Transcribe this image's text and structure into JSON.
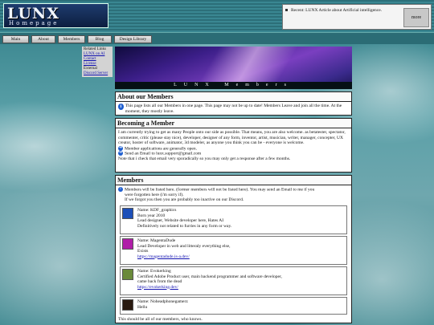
{
  "header": {
    "logo_big": "LUNX",
    "logo_small": "Homepage",
    "notice_text": "Recent: LUNX Article about Artificial intelligence.",
    "notice_more": "more"
  },
  "nav": {
    "items": [
      "Main",
      "About",
      "Members",
      "Blog",
      "Design Library"
    ]
  },
  "sidebar": {
    "heading": "Related Links",
    "links": [
      "LUNX on AI",
      "Contact",
      "License"
    ],
    "external_heading": "External",
    "external_links": [
      "Discord Server"
    ]
  },
  "banner": {
    "caption": "LUNX Members"
  },
  "about": {
    "title": "About our Members",
    "text": "This page lists all our Members in one page. This page may not be up to date! Members Leave and join all the time. At the moment, they mostly leave."
  },
  "becoming": {
    "title": "Becoming a Member",
    "text": "I am currently trying to get as many People onto our side as possible. That means, you are also welcome. as betatester, spectator, commenter, critic (please stay nice), developer, designer of any form, inventor, artist, musician, writer, manager, concepter, UX creator, hoster of software, animator, 3d modeler, as anyone you think you can be - everyone is welcome.",
    "line1": "Member applications are generally open.",
    "line2": "Send an Email to lunx.support@gmail.com",
    "note": "Note that i check that email very sporadically so you may only get a response after a few months."
  },
  "members": {
    "title": "Members",
    "intro1": "Members will be listed here. (former members will not be listed here). You may send an Email to me if you",
    "intro2": "were forgotten here (i'm sorry if).",
    "intro3": "If we forgot you then you are probably too inactive on our Discord.",
    "list": [
      {
        "name": "Name: KDF_graphics",
        "line2": "Born year 2010",
        "line3": "Lead designer, Website developer here, Hates AI",
        "line4": "Definitively not related to furries in any form or way.",
        "avatar_color": "#1d4fb8"
      },
      {
        "name": "Name: MagentaDude",
        "line2": "Lead Developer in web and litteraly everything else,",
        "line3": "Exists",
        "link": "https://magentadude.is-a.dev/",
        "avatar_color": "#b01ea8"
      },
      {
        "name": "Name: Evokerking",
        "line2": "Certified Adobe Product user, main backend programmer and software developer,",
        "line3": "came back from the dead",
        "link": "https://evokerking.dev/",
        "avatar_color": "#6a8a3a"
      },
      {
        "name": "Name: Noheadphonegamerz",
        "line2": "Hellu",
        "avatar_color": "#2a1a10"
      }
    ],
    "footer": "This should be all of our members, who knows."
  }
}
